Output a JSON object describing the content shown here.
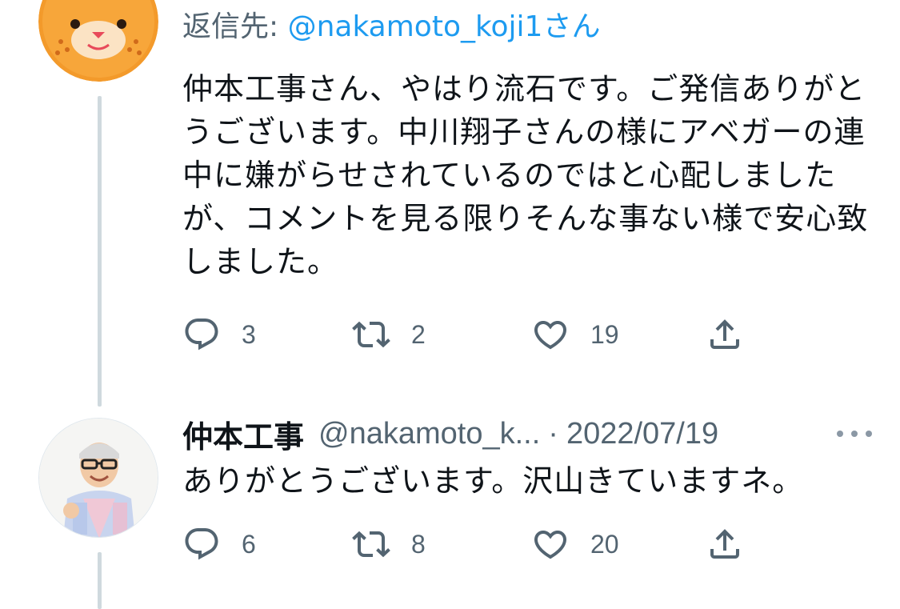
{
  "tweet1": {
    "reply_prefix": "返信先: ",
    "reply_handle": "@nakamoto_koji1",
    "reply_suffix": "さん",
    "text": "仲本工事さん、やはり流石です。ご発信ありがとうございます。中川翔子さんの様にアベガーの連中に嫌がらせされているのではと心配しましたが、コメントを見る限りそんな事ない様で安心致しました。",
    "actions": {
      "replies": "3",
      "retweets": "2",
      "likes": "19"
    }
  },
  "tweet2": {
    "display_name": "仲本工事",
    "handle": "@nakamoto_k...",
    "separator": "·",
    "date": "2022/07/19",
    "text": "ありがとうございます。沢山きていますネ。",
    "actions": {
      "replies": "6",
      "retweets": "8",
      "likes": "20"
    }
  },
  "icons": {
    "reply": "reply-icon",
    "retweet": "retweet-icon",
    "like": "heart-icon",
    "share": "share-icon",
    "more": "more-icon"
  },
  "colors": {
    "text": "#0f1419",
    "secondary": "#536471",
    "link": "#1d9bf0",
    "thread_line": "#cfd9de",
    "avatar_orange": "#f39a2b"
  }
}
